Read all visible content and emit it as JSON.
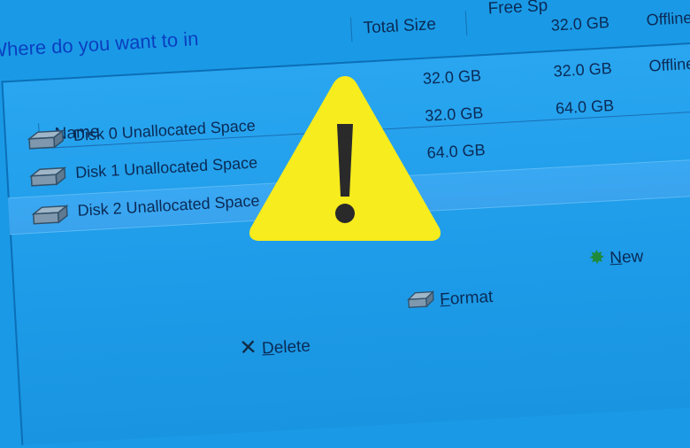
{
  "heading": "Where do you want to in",
  "columns": {
    "name": "Name",
    "total_size": "Total Size",
    "free_space": "Free Sp"
  },
  "rows": [
    {
      "name": "",
      "total_size": "32.0 GB",
      "free_space": "32.0 GB",
      "status": "Offline"
    },
    {
      "name": "Disk 0 Unallocated Space",
      "total_size": "32.0 GB",
      "free_space": "32.0 GB",
      "status": "Offline"
    },
    {
      "name": "Disk 1 Unallocated Space",
      "total_size": "64.0 GB",
      "free_space": "64.0 GB",
      "status": ""
    },
    {
      "name": "Disk 2 Unallocated Space",
      "total_size": "",
      "free_space": "",
      "status": ""
    }
  ],
  "actions": {
    "new": {
      "underlined": "N",
      "rest": "ew"
    },
    "format": {
      "underlined": "F",
      "rest": "ormat"
    },
    "delete": {
      "underlined": "D",
      "rest": "elete"
    }
  },
  "icons": [
    "disk-icon",
    "warning-icon",
    "new-icon",
    "format-icon",
    "delete-icon"
  ],
  "colors": {
    "background": "#1a9ae6",
    "warning_fill": "#f7ec1d",
    "heading_text": "#0a3fc0"
  }
}
